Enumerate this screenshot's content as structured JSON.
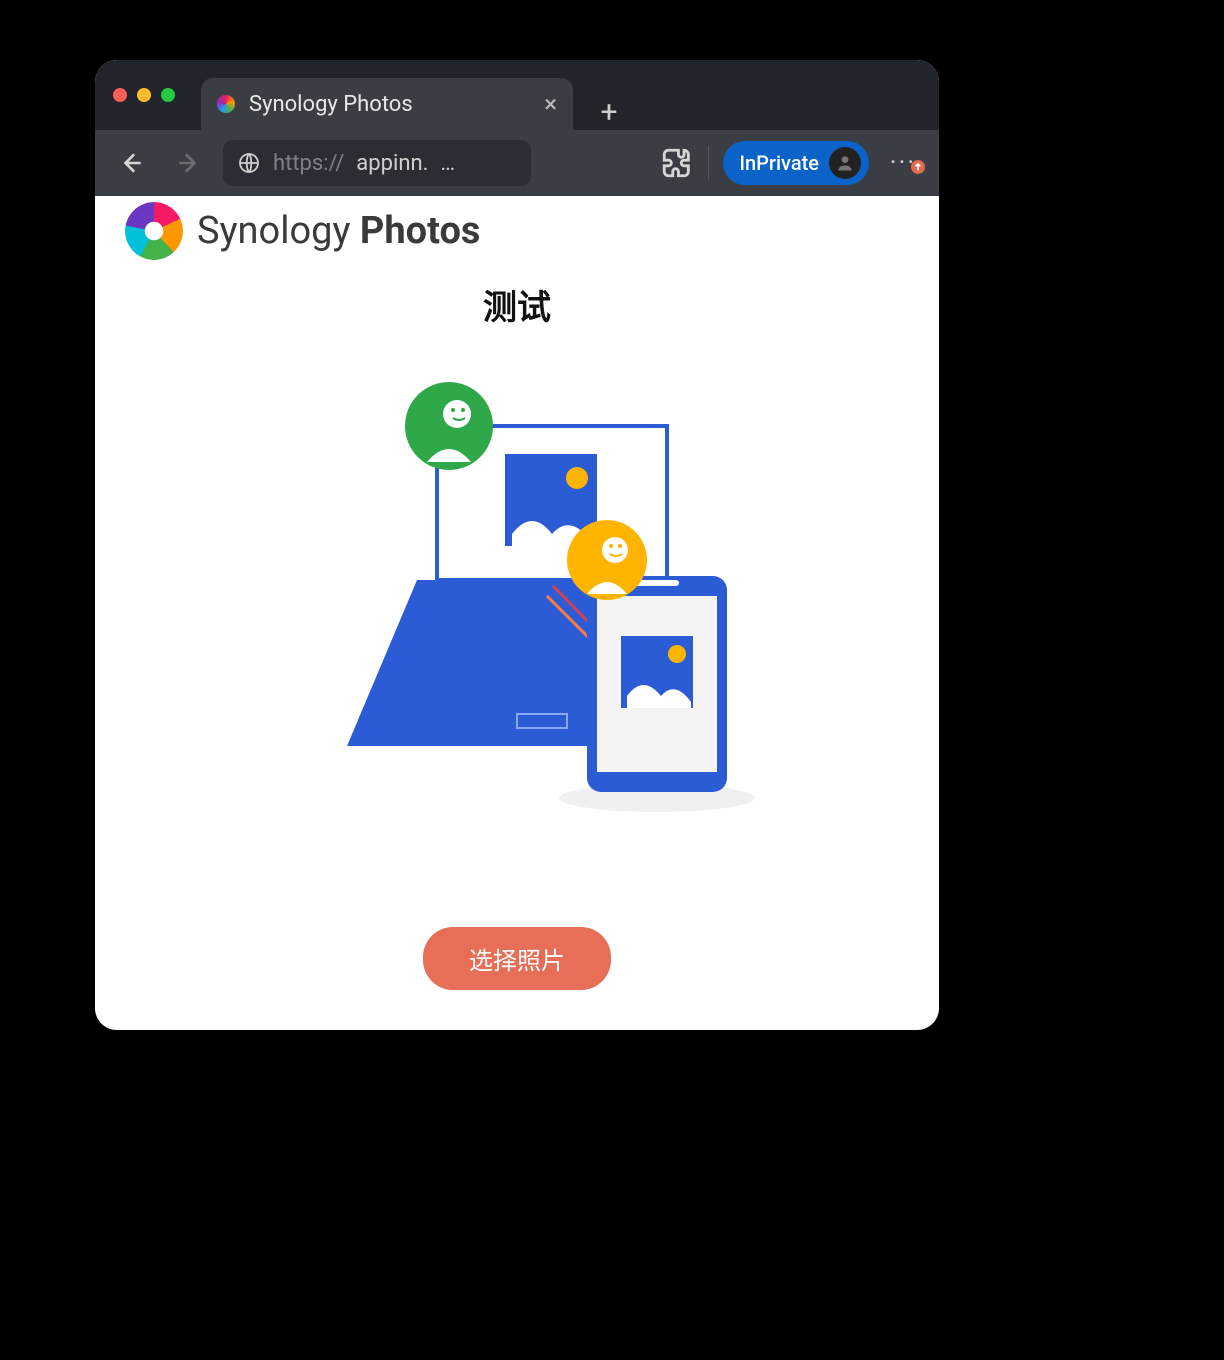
{
  "browser": {
    "tab_title": "Synology Photos",
    "address_prefix": "https://",
    "address_host": "appinn.",
    "address_truncation": "…",
    "inprivate_label": "InPrivate"
  },
  "page": {
    "brand_word_light": "Synology",
    "brand_word_bold": "Photos",
    "subtitle": "测试",
    "cta_label": "选择照片"
  }
}
